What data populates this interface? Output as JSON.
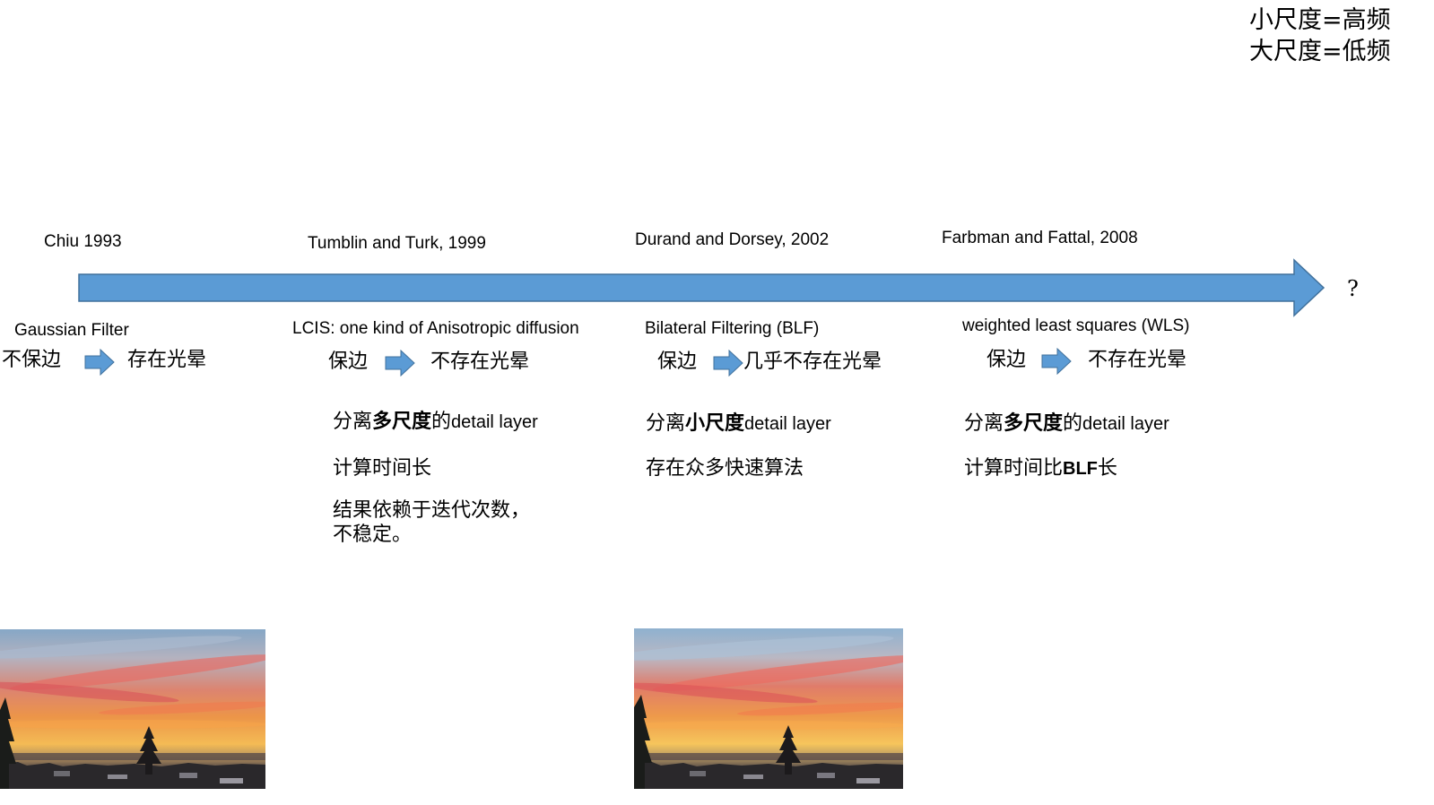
{
  "legend": {
    "small_scale": "小尺度=高频",
    "large_scale": "大尺度=低频"
  },
  "timeline": {
    "end_label": "?",
    "milestones": [
      {
        "year_label": "Chiu 1993",
        "method": "Gaussian Filter",
        "edge": "不保边",
        "halo": "存在光晕"
      },
      {
        "year_label": "Tumblin and Turk, 1999",
        "method": "LCIS: one kind of Anisotropic diffusion",
        "edge": "保边",
        "halo": "不存在光晕",
        "detail": {
          "prefix": "分离",
          "bold": "多尺度",
          "joiner": "的",
          "latin": "detail layer"
        },
        "remark": "计算时间长",
        "note": [
          "结果依赖于迭代次数，",
          "不稳定。"
        ]
      },
      {
        "year_label": "Durand and Dorsey, 2002",
        "method": "Bilateral Filtering (BLF)",
        "edge": "保边",
        "halo": "几乎不存在光晕",
        "detail": {
          "prefix": "分离",
          "bold": "小尺度",
          "latin": "detail layer"
        },
        "remark": "存在众多快速算法"
      },
      {
        "year_label": "Farbman and Fattal, 2008",
        "method": "weighted least squares (WLS)",
        "edge": "保边",
        "halo": "不存在光晕",
        "detail": {
          "prefix": "分离",
          "bold": "多尺度",
          "joiner": "的",
          "latin": "detail layer"
        },
        "remark": {
          "prefix": "计算时间比",
          "bold": "BLF",
          "suffix": "长"
        }
      }
    ]
  },
  "icons": {
    "transition": "arrow-right-icon",
    "timeline": "timeline-arrow-icon"
  },
  "colors": {
    "arrow_fill": "#5b9bd5",
    "arrow_stroke": "#41719c",
    "text": "#000000"
  }
}
